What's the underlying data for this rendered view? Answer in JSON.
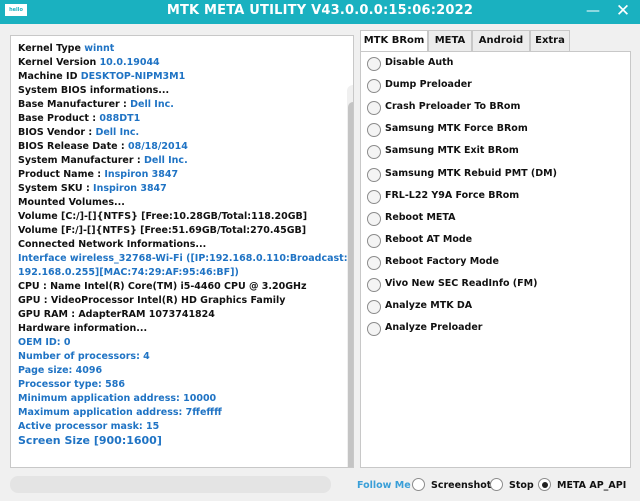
{
  "window": {
    "logo_text": "hello",
    "title": "MTK META UTILITY V43.0.0.0:15:06:2022",
    "minimize_glyph": "—",
    "close_glyph": "✕"
  },
  "log": [
    {
      "label": "Kernel Type ",
      "value": "winnt"
    },
    {
      "label": "Kernel Version ",
      "value": "10.0.19044"
    },
    {
      "label": "Machine ID ",
      "value": "DESKTOP-NIPM3M1"
    },
    {
      "label": "System BIOS informations...",
      "value": ""
    },
    {
      "label": "Base Manufacturer : ",
      "value": "Dell Inc."
    },
    {
      "label": "Base Product : ",
      "value": "088DT1"
    },
    {
      "label": "BIOS Vendor : ",
      "value": "Dell Inc."
    },
    {
      "label": "BIOS Release Date : ",
      "value": "08/18/2014"
    },
    {
      "label": "System Manufacturer : ",
      "value": "Dell Inc."
    },
    {
      "label": "Product Name : ",
      "value": "Inspiron 3847"
    },
    {
      "label": "System SKU : ",
      "value": "Inspiron 3847"
    },
    {
      "label": "Mounted Volumes...",
      "value": ""
    },
    {
      "label": "Volume [C:/]-[]{NTFS} [Free:10.28GB/Total:118.20GB]",
      "value": ""
    },
    {
      "label": "Volume [F:/]-[]{NTFS} [Free:51.69GB/Total:270.45GB]",
      "value": ""
    },
    {
      "label": "Connected Network Informations...",
      "value": ""
    },
    {
      "label": "",
      "value": "Interface wireless_32768-Wi-Fi ([IP:192.168.0.110:Broadcast:"
    },
    {
      "label": "",
      "value": "192.168.0.255][MAC:74:29:AF:95:46:BF])"
    },
    {
      "label": "CPU   : Name Intel(R) Core(TM) i5-4460 CPU @ 3.20GHz",
      "value": ""
    },
    {
      "label": "GPU  : VideoProcessor Intel(R) HD Graphics Family",
      "value": ""
    },
    {
      "label": "GPU RAM  : AdapterRAM 1073741824",
      "value": ""
    },
    {
      "label": "Hardware information...",
      "value": ""
    },
    {
      "label": "",
      "value": "OEM ID: 0"
    },
    {
      "label": "",
      "value": "Number of processors: 4"
    },
    {
      "label": "",
      "value": "Page size: 4096"
    },
    {
      "label": "",
      "value": "Processor type: 586"
    },
    {
      "label": "",
      "value": "Minimum application address: 10000"
    },
    {
      "label": "",
      "value": "Maximum application address: 7ffeffff"
    },
    {
      "label": "",
      "value": "Active processor mask: 15"
    },
    {
      "label": "",
      "value": "Screen Size [900:1600]"
    }
  ],
  "tabs": [
    {
      "label": "MTK BRom",
      "active": true
    },
    {
      "label": "META",
      "active": false
    },
    {
      "label": "Android",
      "active": false
    },
    {
      "label": "Extra",
      "active": false
    }
  ],
  "options": [
    "Disable Auth",
    "Dump Preloader",
    "Crash Preloader To BRom",
    "Samsung MTK Force BRom",
    "Samsung MTK Exit BRom",
    "Samsung MTK Rebuid PMT (DM)",
    "FRL-L22 Y9A Force BRom",
    "Reboot META",
    "Reboot AT Mode",
    "Reboot Factory Mode",
    "Vivo New SEC ReadInfo (FM)",
    "Analyze MTK DA",
    "Analyze Preloader"
  ],
  "bottom": {
    "follow_label": "Follow Me",
    "screenshot_label": "Screenshot",
    "stop_label": "Stop",
    "meta_label": "META AP_API",
    "selected": "META AP_API"
  }
}
